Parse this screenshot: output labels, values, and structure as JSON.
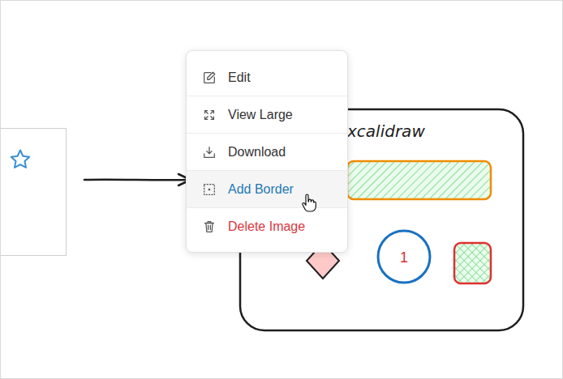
{
  "canvas": {
    "title": "xcalidraw",
    "badge": "1"
  },
  "menu": {
    "items": [
      {
        "label": "Edit",
        "selected": false,
        "kind": "normal"
      },
      {
        "label": "View Large",
        "selected": false,
        "kind": "normal"
      },
      {
        "label": "Download",
        "selected": false,
        "kind": "normal"
      },
      {
        "label": "Add Border",
        "selected": true,
        "kind": "normal"
      },
      {
        "label": "Delete Image",
        "selected": false,
        "kind": "danger"
      }
    ]
  }
}
